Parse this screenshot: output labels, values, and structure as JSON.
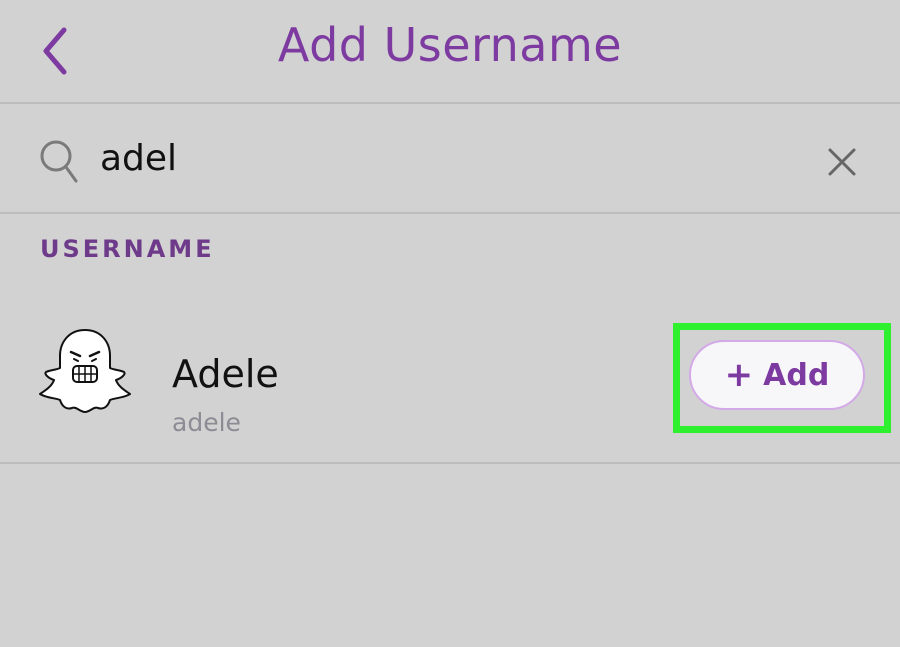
{
  "header": {
    "title": "Add Username",
    "back_icon": "chevron-left-icon"
  },
  "search": {
    "value": "adel",
    "placeholder": "",
    "search_icon": "search-icon",
    "clear_icon": "close-icon"
  },
  "results": {
    "section_label": "USERNAME",
    "items": [
      {
        "display_name": "Adele",
        "username": "adele",
        "avatar_icon": "bitmoji-ghost-avatar",
        "add_button": {
          "plus": "+",
          "label": "Add"
        }
      }
    ]
  },
  "colors": {
    "accent": "#7d3aa0",
    "background": "#d2d2d2",
    "highlight": "#2ef02e",
    "divider": "#bdbdbd"
  }
}
